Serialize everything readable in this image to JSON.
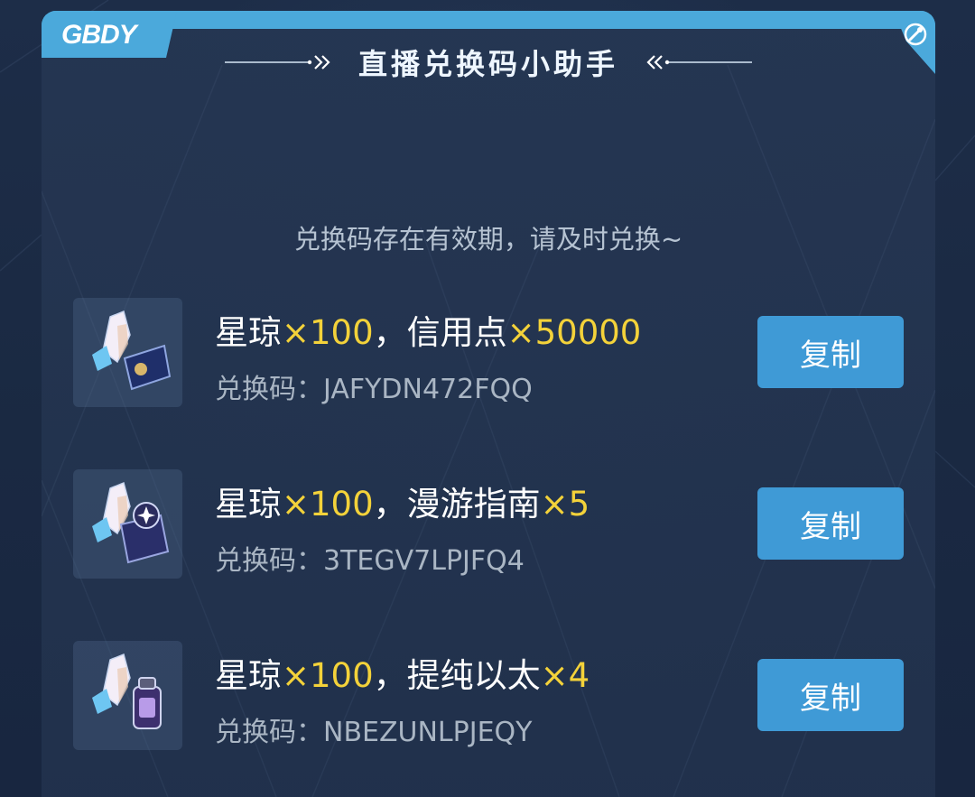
{
  "header": {
    "logo_text": "GBDY",
    "title": "直播兑换码小助手"
  },
  "notice": "兑换码存在有效期，请及时兑换~",
  "items": [
    {
      "title_parts": [
        "星琼",
        "×100",
        "，信用点",
        "×50000"
      ],
      "code_label": "兑换码：",
      "code": "JAFYDN472FQQ",
      "button_label": "复制",
      "icon": "crystal-and-credit-card-icon"
    },
    {
      "title_parts": [
        "星琼",
        "×100",
        "，漫游指南",
        "×5"
      ],
      "code_label": "兑换码：",
      "code": "3TEGV7LPJFQ4",
      "button_label": "复制",
      "icon": "crystal-and-guidebook-icon"
    },
    {
      "title_parts": [
        "星琼",
        "×100",
        "，提纯以太",
        "×4"
      ],
      "code_label": "兑换码：",
      "code": "NBEZUNLPJEQY",
      "button_label": "复制",
      "icon": "crystal-and-ether-bottle-icon"
    }
  ],
  "colors": {
    "accent": "#4ba9db",
    "button": "#3f9ad6",
    "highlight": "#f3d23a"
  }
}
